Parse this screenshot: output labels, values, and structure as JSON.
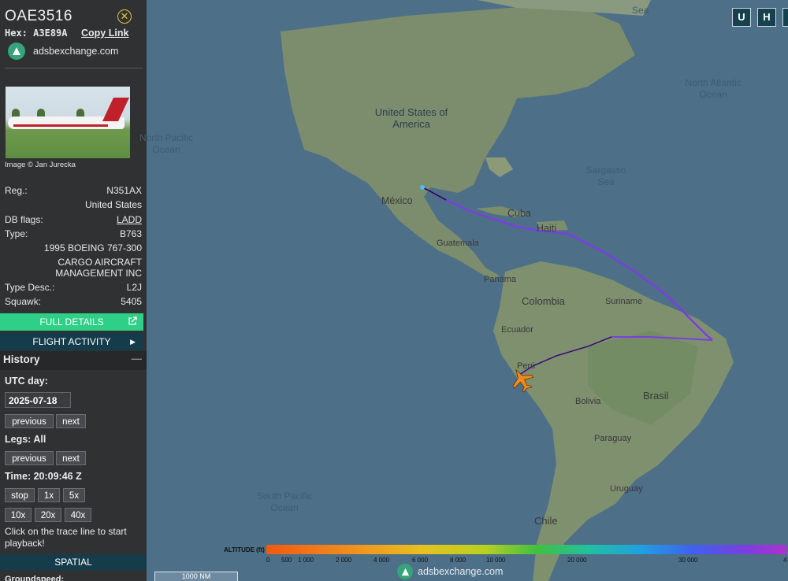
{
  "aircraft": {
    "callsign": "OAE3516",
    "hex_label": "Hex:",
    "hex": "A3E89A",
    "copy_link": "Copy Link",
    "site": "adsbexchange.com",
    "image_credit": "Image © Jan Jurecka",
    "reg_label": "Reg.:",
    "reg": "N351AX",
    "country": "United States",
    "dbflags_label": "DB flags:",
    "dbflags": "LADD",
    "type_label": "Type:",
    "type": "B763",
    "model": "1995 BOEING 767-300",
    "operator_line1": "CARGO AIRCRAFT",
    "operator_line2": "MANAGEMENT INC",
    "typedesc_label": "Type Desc.:",
    "typedesc": "L2J",
    "squawk_label": "Squawk:",
    "squawk": "5405"
  },
  "buttons": {
    "full_details": "FULL DETAILS",
    "flight_activity": "FLIGHT ACTIVITY"
  },
  "history": {
    "title": "History",
    "utc_day_label": "UTC day:",
    "date": "2025-07-18",
    "previous": "previous",
    "next": "next",
    "legs_label": "Legs: All",
    "time_label": "Time: 20:09:46 Z",
    "stop": "stop",
    "s1x": "1x",
    "s5x": "5x",
    "s10x": "10x",
    "s20x": "20x",
    "s40x": "40x",
    "help": "Click on the trace line to start playback!",
    "spatial": "SPATIAL",
    "groundspeed": "Groundspeed:"
  },
  "map": {
    "labels": {
      "sea": "Sea",
      "north_atlantic": "North Atlantic Ocean",
      "north_pacific": "North Pacific Ocean",
      "usa": "United States of America",
      "sargasso": "Sargasso Sea",
      "mexico": "México",
      "cuba": "Cuba",
      "haiti": "Haiti",
      "guatemala": "Guatemala",
      "panama": "Panama",
      "colombia": "Colombia",
      "suriname": "Suriname",
      "ecuador": "Ecuador",
      "peru": "Perú",
      "brasil": "Brasil",
      "bolivia": "Bolivia",
      "paraguay": "Paraguay",
      "uruguay": "Uruguay",
      "chile": "Chile",
      "south_pacific": "South Pacific Ocean"
    },
    "btn_u": "U",
    "btn_h": "H",
    "scale": "1000 NM",
    "footer_site": "adsbexchange.com"
  },
  "altitude_legend": {
    "title": "ALTITUDE (ft)",
    "ticks": [
      "0",
      "500",
      "1 000",
      "2 000",
      "4 000",
      "6 000",
      "8 000",
      "10 000",
      "20 000",
      "30 000",
      "4"
    ]
  },
  "colors": {
    "accent_green": "#2ecf86",
    "teal": "#153c4a",
    "track_purple": "#7a3fe0",
    "aircraft_orange": "#f08a1e"
  }
}
